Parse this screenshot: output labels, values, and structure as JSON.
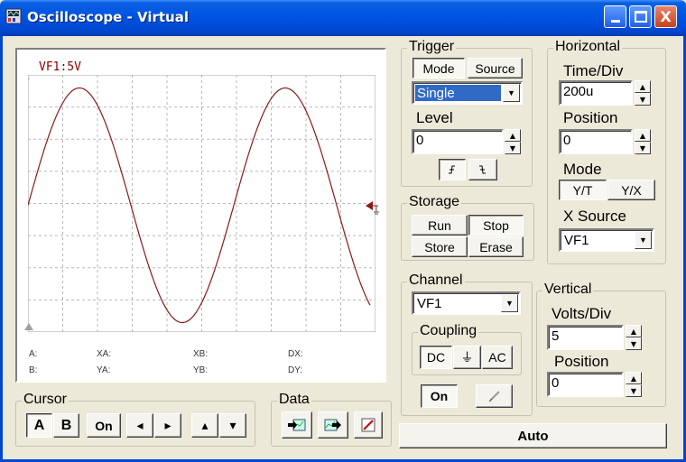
{
  "window": {
    "title": "Oscilloscope - Virtual",
    "minimize": "_",
    "maximize": "□",
    "close": "X"
  },
  "screen": {
    "channel_label": "VF1:5V",
    "readouts": {
      "a": "A:",
      "b": "B:",
      "xa": "XA:",
      "ya": "YA:",
      "xb": "XB:",
      "yb": "YB:",
      "dx": "DX:",
      "dy": "DY:"
    },
    "trace_color": "#8B1A1A",
    "grid_color": "#B8B8B8"
  },
  "trigger": {
    "title": "Trigger",
    "mode_label": "Mode",
    "source_label": "Source",
    "mode_value": "Single",
    "level_label": "Level",
    "level_value": "0",
    "rising_icon": "⨍",
    "falling_icon": "ʅ"
  },
  "storage": {
    "title": "Storage",
    "run": "Run",
    "stop": "Stop",
    "store": "Store",
    "erase": "Erase"
  },
  "horizontal": {
    "title": "Horizontal",
    "time_div_label": "Time/Div",
    "time_div_value": "200u",
    "position_label": "Position",
    "position_value": "0",
    "mode_label": "Mode",
    "yt": "Y/T",
    "yx": "Y/X",
    "xsource_label": "X Source",
    "xsource_value": "VF1"
  },
  "channel": {
    "title": "Channel",
    "value": "VF1",
    "coupling_title": "Coupling",
    "dc": "DC",
    "gnd": "⏚",
    "ac": "AC",
    "on": "On"
  },
  "vertical": {
    "title": "Vertical",
    "volts_div_label": "Volts/Div",
    "volts_div_value": "5",
    "position_label": "Position",
    "position_value": "0"
  },
  "cursor": {
    "title": "Cursor",
    "a": "A",
    "b": "B",
    "on": "On",
    "left": "◂",
    "right": "▸",
    "up": "▴",
    "down": "▾"
  },
  "data": {
    "title": "Data"
  },
  "auto": "Auto"
}
